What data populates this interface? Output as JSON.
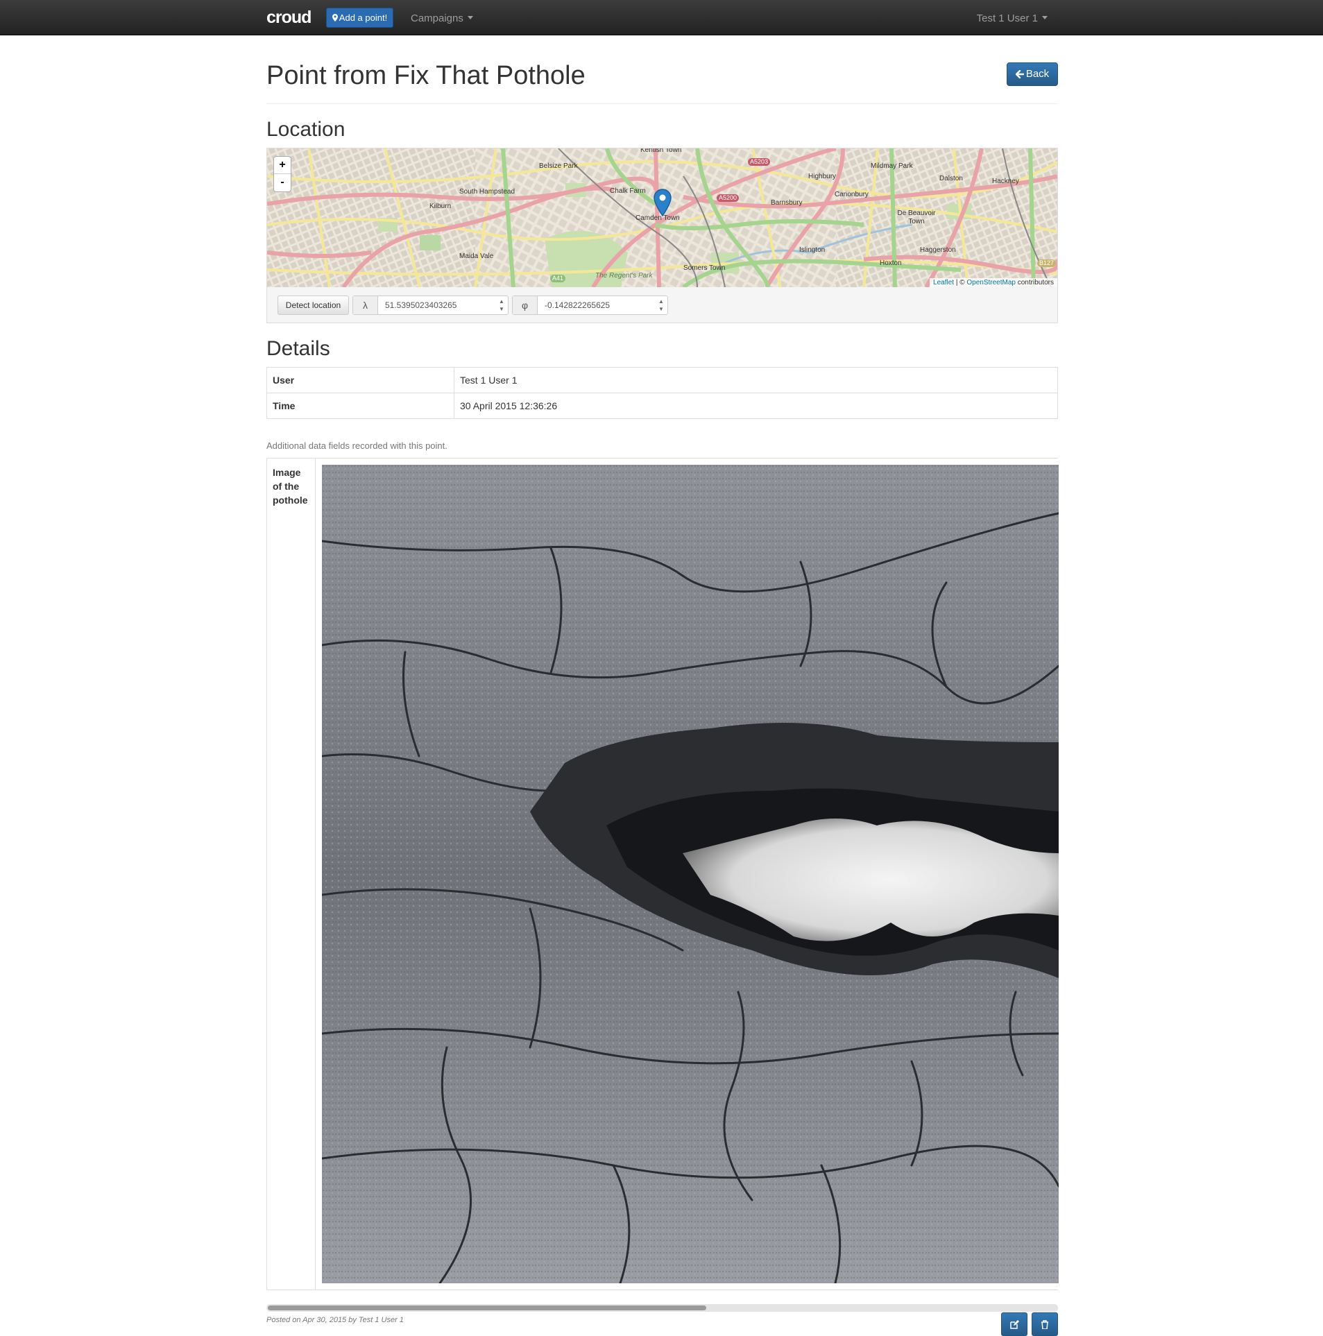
{
  "navbar": {
    "brand": "croud",
    "add_point": "Add a point!",
    "campaigns": "Campaigns",
    "user": "Test 1 User 1"
  },
  "header": {
    "title": "Point from Fix That Pothole",
    "back": "Back"
  },
  "location": {
    "heading": "Location",
    "map_labels": {
      "kentish_town": "Kentish Town",
      "belsize_park": "Belsize Park",
      "south_hampstead": "South Hampstead",
      "kilburn": "Kilburn",
      "chalk_farm": "Chalk Farm",
      "camden_town": "Camden Town",
      "maida_vale": "Maida Vale",
      "the_regents_park": "The Regent's Park",
      "somers_town": "Somers Town",
      "highbury": "Highbury",
      "mildmay_park": "Mildmay Park",
      "dalston": "Dalston",
      "hackney": "Hackney",
      "canonbury": "Canonbury",
      "barnsbury": "Barnsbury",
      "de_beauvoir_town": "De Beauvoir Town",
      "islington": "Islington",
      "haggerston": "Haggerston",
      "hoxton": "Hoxton",
      "a5203": "A5203",
      "a5200": "A5200",
      "a41": "A41",
      "b127": "B127"
    },
    "zoom_in": "+",
    "zoom_out": "-",
    "attribution_leaflet": "Leaflet",
    "attribution_sep": " | © ",
    "attribution_osm": "OpenStreetMap",
    "attribution_tail": " contributors",
    "detect_location": "Detect location",
    "lambda_symbol": "λ",
    "phi_symbol": "φ",
    "latitude": "51.5395023403265",
    "longitude": "-0.142822265625"
  },
  "details": {
    "heading": "Details",
    "rows": [
      {
        "key": "User",
        "value": "Test 1 User 1"
      },
      {
        "key": "Time",
        "value": "30 April 2015 12:36:26"
      }
    ],
    "note": "Additional data fields recorded with this point.",
    "image_field_label": "Image of the pothole"
  },
  "footer": {
    "posted": "Posted on Apr 30, 2015 by Test 1 User 1"
  },
  "icons": {
    "add_point": "map-marker-icon",
    "back": "arrow-left-icon",
    "edit": "edit-icon",
    "delete": "trash-icon"
  }
}
